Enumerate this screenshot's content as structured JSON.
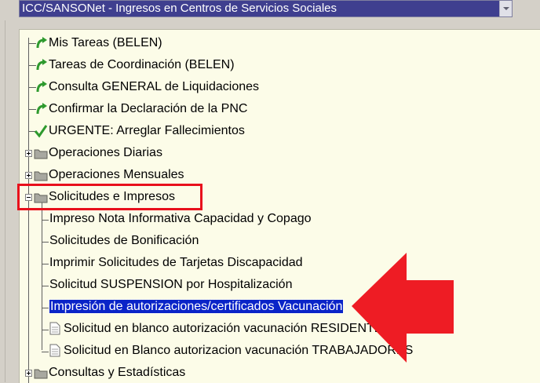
{
  "window": {
    "module_select": "ICC/SANSONet - Ingresos en Centros de Servicios Sociales"
  },
  "tree": {
    "items": [
      {
        "label": "Mis Tareas (BELEN)",
        "icon": "task-arrow-icon"
      },
      {
        "label": "Tareas de Coordinación (BELEN)",
        "icon": "task-arrow-icon"
      },
      {
        "label": "Consulta GENERAL de Liquidaciones",
        "icon": "task-arrow-icon"
      },
      {
        "label": "Confirmar la Declaración de la PNC",
        "icon": "task-arrow-icon"
      },
      {
        "label": "URGENTE: Arreglar Fallecimientos",
        "icon": "checkmark-icon"
      },
      {
        "label": "Operaciones Diarias",
        "icon": "folder-icon"
      },
      {
        "label": "Operaciones Mensuales",
        "icon": "folder-icon"
      },
      {
        "label": "Solicitudes e Impresos",
        "icon": "folder-open-icon"
      },
      {
        "label": "Impreso Nota Informativa Capacidad y Copago"
      },
      {
        "label": "Solicitudes de Bonificación"
      },
      {
        "label": "Imprimir Solicitudes de Tarjetas Discapacidad"
      },
      {
        "label": "Solicitud SUSPENSION por Hospitalización"
      },
      {
        "label": "Impresión de autorizaciones/certificados Vacunación"
      },
      {
        "label": "Solicitud en blanco autorización vacunación RESIDENTES",
        "icon": "document-icon"
      },
      {
        "label": "Solicitud en Blanco autorizacion vacunación TRABAJADORES",
        "icon": "document-icon"
      },
      {
        "label": "Consultas y Estadísticas",
        "icon": "folder-icon"
      }
    ]
  },
  "annotation": {
    "highlight_color": "#e8101c",
    "selected_color": "#0a24c8"
  }
}
